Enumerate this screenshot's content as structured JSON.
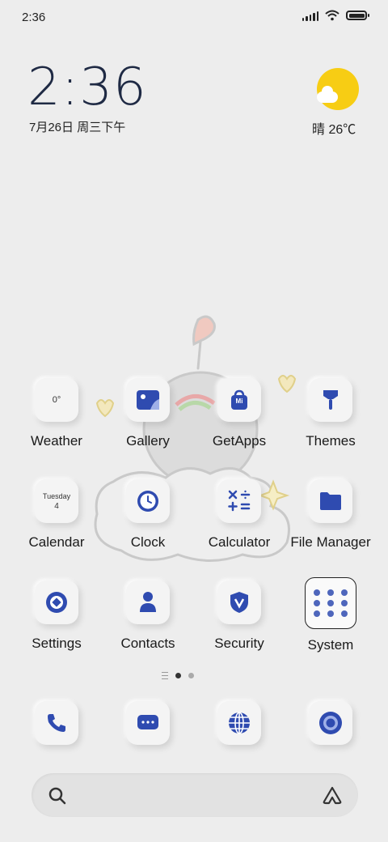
{
  "status_bar": {
    "time": "2:36"
  },
  "clock_widget": {
    "time": "2:36",
    "date": "7月26日 周三下午"
  },
  "weather_widget": {
    "condition_temp": "晴 26℃"
  },
  "apps": {
    "weather": {
      "label": "Weather",
      "icon_text": "0°"
    },
    "gallery": {
      "label": "Gallery"
    },
    "getapps": {
      "label": "GetApps",
      "icon_text": "Mi"
    },
    "themes": {
      "label": "Themes"
    },
    "calendar": {
      "label": "Calendar",
      "weekday": "Tuesday",
      "day": "4"
    },
    "clock": {
      "label": "Clock"
    },
    "calculator": {
      "label": "Calculator"
    },
    "file_manager": {
      "label": "File Manager"
    },
    "settings": {
      "label": "Settings"
    },
    "contacts": {
      "label": "Contacts"
    },
    "security": {
      "label": "Security"
    },
    "system": {
      "label": "System"
    }
  },
  "page_indicator": {
    "total_pages": 2,
    "current_page": 1
  },
  "dock": [
    "phone-icon",
    "messages-icon",
    "browser-icon",
    "camera-icon"
  ],
  "colors": {
    "accent": "#2f4bb0",
    "sun": "#f7cd14",
    "background": "#ededed"
  }
}
